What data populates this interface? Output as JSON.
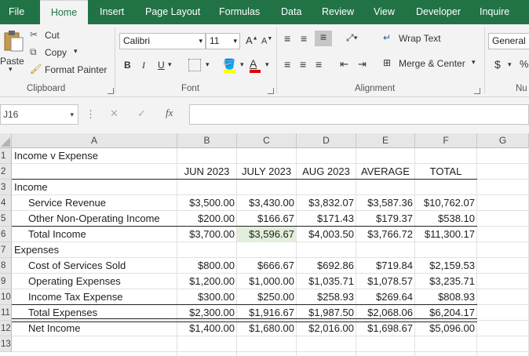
{
  "tabs": [
    "File",
    "Home",
    "Insert",
    "Page Layout",
    "Formulas",
    "Data",
    "Review",
    "View",
    "Developer",
    "Inquire"
  ],
  "clipboard": {
    "paste": "Paste",
    "cut": "Cut",
    "copy": "Copy",
    "format_painter": "Format Painter",
    "label": "Clipboard"
  },
  "font": {
    "name": "Calibri",
    "size": "11",
    "bold": "B",
    "italic": "I",
    "underline": "U",
    "grow": "A",
    "shrink": "A",
    "color_letter": "A",
    "label": "Font"
  },
  "alignment": {
    "wrap": "Wrap Text",
    "merge": "Merge & Center",
    "label": "Alignment"
  },
  "number": {
    "format": "General",
    "currency": "$",
    "percent": "%",
    "label": "Nu"
  },
  "formula_bar": {
    "name_box": "J16",
    "cancel": "✕",
    "enter": "✓",
    "fx": "fx",
    "value": ""
  },
  "columns": [
    "A",
    "B",
    "C",
    "D",
    "E",
    "F",
    "G"
  ],
  "rows": [
    {
      "n": "1",
      "a": "Income v Expense",
      "indent": 0,
      "vals": [
        "",
        "",
        "",
        "",
        ""
      ]
    },
    {
      "n": "2",
      "a": "",
      "indent": 0,
      "vals": [
        "JUN 2023",
        "JULY 2023",
        "AUG 2023",
        "AVERAGE",
        "TOTAL"
      ],
      "header": true
    },
    {
      "n": "3",
      "a": "Income",
      "indent": 0,
      "vals": [
        "",
        "",
        "",
        "",
        ""
      ]
    },
    {
      "n": "4",
      "a": "Service Revenue",
      "indent": 1,
      "vals": [
        "$3,500.00",
        "$3,430.00",
        "$3,832.07",
        "$3,587.36",
        "$10,762.07"
      ]
    },
    {
      "n": "5",
      "a": "Other Non-Operating Income",
      "indent": 1,
      "vals": [
        "$200.00",
        "$166.67",
        "$171.43",
        "$179.37",
        "$538.10"
      ]
    },
    {
      "n": "6",
      "a": "Total Income",
      "indent": 1,
      "vals": [
        "$3,700.00",
        "$3,596.67",
        "$4,003.50",
        "$3,766.72",
        "$11,300.17"
      ]
    },
    {
      "n": "7",
      "a": "Expenses",
      "indent": 0,
      "vals": [
        "",
        "",
        "",
        "",
        ""
      ]
    },
    {
      "n": "8",
      "a": "Cost of Services Sold",
      "indent": 1,
      "vals": [
        "$800.00",
        "$666.67",
        "$692.86",
        "$719.84",
        "$2,159.53"
      ]
    },
    {
      "n": "9",
      "a": "Operating Expenses",
      "indent": 1,
      "vals": [
        "$1,200.00",
        "$1,000.00",
        "$1,035.71",
        "$1,078.57",
        "$3,235.71"
      ]
    },
    {
      "n": "10",
      "a": "Income Tax Expense",
      "indent": 1,
      "vals": [
        "$300.00",
        "$250.00",
        "$258.93",
        "$269.64",
        "$808.93"
      ]
    },
    {
      "n": "11",
      "a": "Total Expenses",
      "indent": 1,
      "vals": [
        "$2,300.00",
        "$1,916.67",
        "$1,987.50",
        "$2,068.06",
        "$6,204.17"
      ]
    },
    {
      "n": "12",
      "a": "Net Income",
      "indent": 1,
      "vals": [
        "$1,400.00",
        "$1,680.00",
        "$2,016.00",
        "$1,698.67",
        "$5,096.00"
      ]
    },
    {
      "n": "13",
      "a": "",
      "indent": 0,
      "vals": [
        "",
        "",
        "",
        "",
        ""
      ]
    }
  ],
  "highlighted_cell": "C6",
  "colors": {
    "accent": "#217346",
    "highlight": "#e2efda",
    "font_red": "#e00000",
    "fill_yellow": "#ffff00"
  }
}
